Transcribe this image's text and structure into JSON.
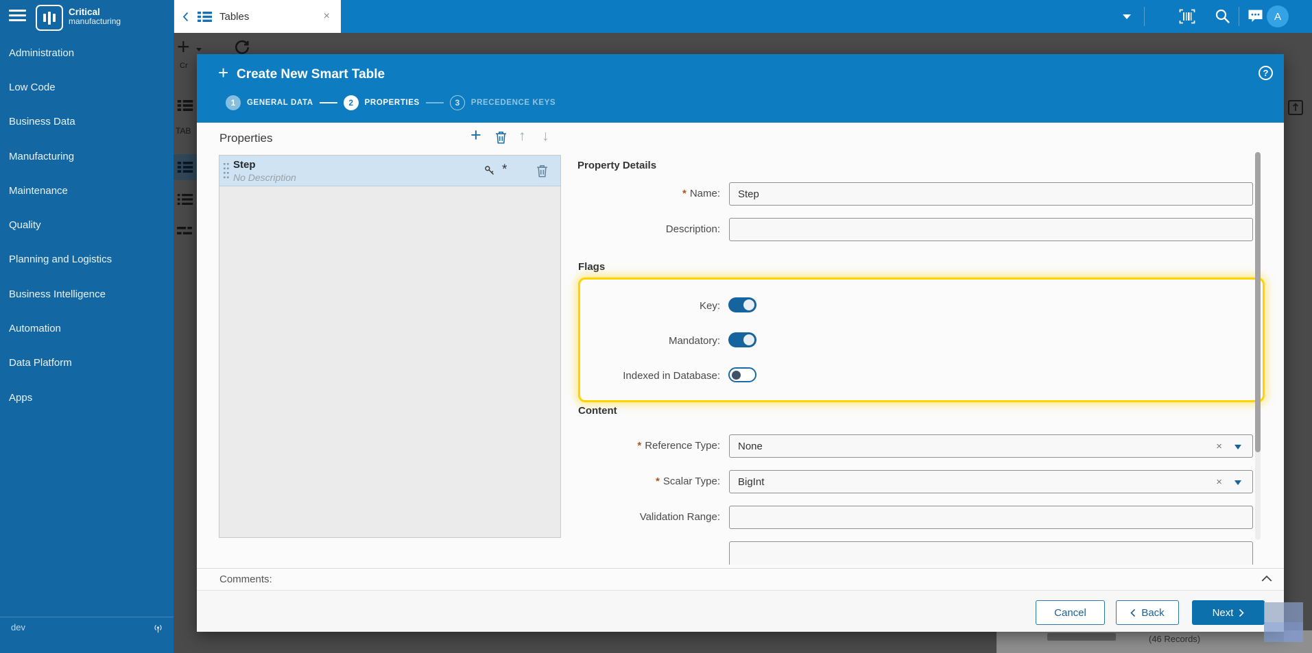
{
  "brand": {
    "name": "Critical",
    "sub": "manufacturing"
  },
  "sidebar": {
    "items": [
      {
        "label": "Administration"
      },
      {
        "label": "Low Code"
      },
      {
        "label": "Business Data"
      },
      {
        "label": "Manufacturing"
      },
      {
        "label": "Maintenance"
      },
      {
        "label": "Quality"
      },
      {
        "label": "Planning and Logistics"
      },
      {
        "label": "Business Intelligence"
      },
      {
        "label": "Automation"
      },
      {
        "label": "Data Platform"
      },
      {
        "label": "Apps"
      }
    ],
    "env": "dev"
  },
  "tabbar": {
    "active_tab": "Tables",
    "close": "×"
  },
  "topbar": {
    "avatar_initial": "A"
  },
  "modal": {
    "title": "Create New Smart Table",
    "plus": "+",
    "help": "?",
    "steps": [
      {
        "num": "1",
        "label": "GENERAL DATA",
        "state": "done"
      },
      {
        "num": "2",
        "label": "PROPERTIES",
        "state": "active"
      },
      {
        "num": "3",
        "label": "PRECEDENCE KEYS",
        "state": "pending"
      }
    ],
    "panel": {
      "title": "Properties",
      "up_arrow": "↑",
      "down_arrow": "↓",
      "add": "+",
      "item": {
        "name": "Step",
        "description": "No Description"
      }
    },
    "details": {
      "heading": "Property Details",
      "required_marker": "*",
      "name_label": "Name:",
      "name_value": "Step",
      "description_label": "Description:",
      "description_value": "",
      "flags_heading": "Flags",
      "toggles": [
        {
          "label": "Key:",
          "on": true
        },
        {
          "label": "Mandatory:",
          "on": true
        },
        {
          "label": "Indexed in Database:",
          "on": false
        }
      ],
      "content_heading": "Content",
      "reference_label": "Reference Type:",
      "reference_value": "None",
      "scalar_label": "Scalar Type:",
      "scalar_value": "BigInt",
      "validation_label": "Validation Range:",
      "validation_value": "",
      "clear_glyph": "×"
    },
    "comments_label": "Comments:",
    "buttons": {
      "cancel": "Cancel",
      "back": "Back",
      "next": "Next"
    }
  },
  "background": {
    "records": "(46 Records)",
    "column_fragment": "TAB",
    "create_fragment": "Cr",
    "toolbar_plus": "+"
  },
  "colors": {
    "primary": "#0d7cc1",
    "sidebar": "#1368a4",
    "toggle_on": "#15649f",
    "highlight": "#ffd400",
    "selected_row": "#cfe3f2"
  }
}
